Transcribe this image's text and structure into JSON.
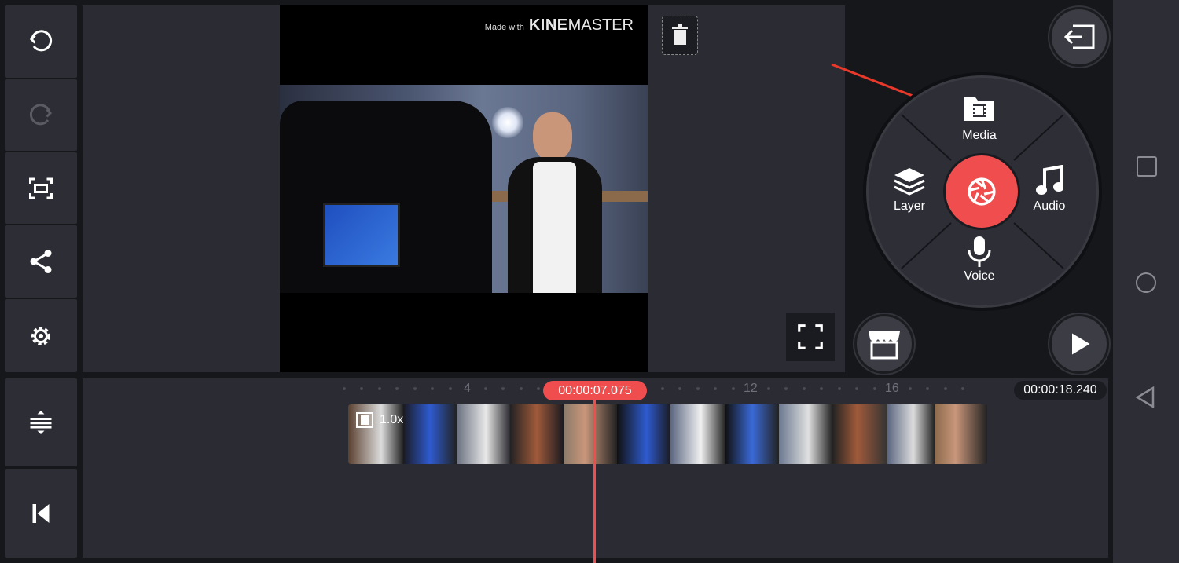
{
  "watermark": {
    "made_with": "Made with",
    "brand_bold": "KINE",
    "brand_light": "MASTER"
  },
  "wheel": {
    "media_label": "Media",
    "layer_label": "Layer",
    "audio_label": "Audio",
    "voice_label": "Voice"
  },
  "timeline": {
    "playhead_time": "00:00:07.075",
    "total_time": "00:00:18.240",
    "clip_speed": "1.0x",
    "ruler_labels": [
      "4",
      "12",
      "16"
    ]
  },
  "colors": {
    "accent": "#f04e4e",
    "panel": "#2a2b33",
    "background": "#16171b"
  }
}
